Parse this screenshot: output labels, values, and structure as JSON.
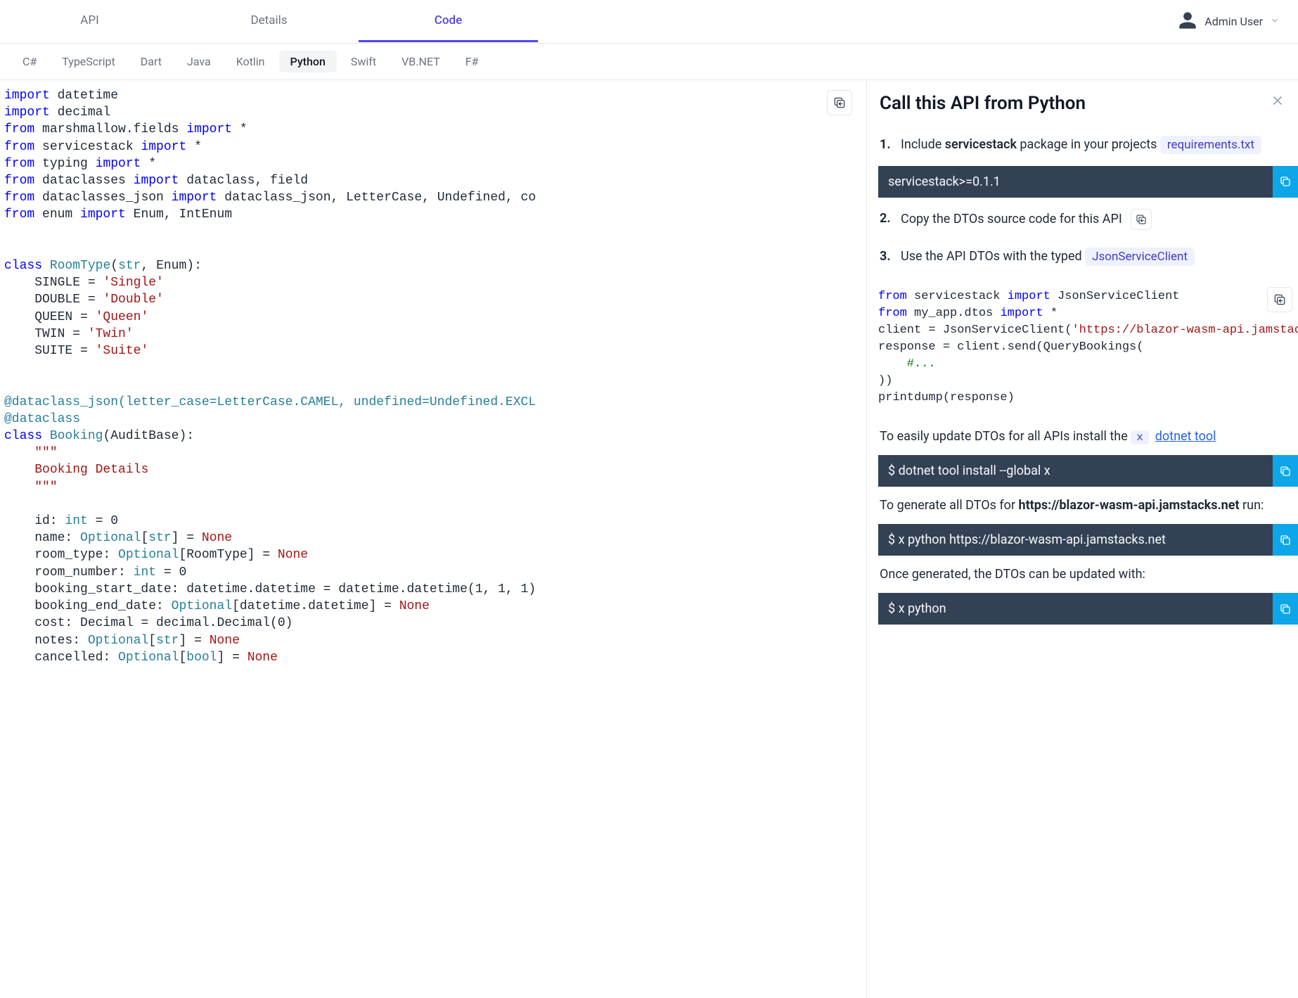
{
  "header": {
    "tabs": [
      "API",
      "Details",
      "Code"
    ],
    "active_tab": 2,
    "user": "Admin User"
  },
  "lang_tabs": {
    "items": [
      "C#",
      "TypeScript",
      "Dart",
      "Java",
      "Kotlin",
      "Python",
      "Swift",
      "VB.NET",
      "F#"
    ],
    "active": 5
  },
  "code": {
    "imports": [
      {
        "type": "import",
        "module": "datetime"
      },
      {
        "type": "import",
        "module": "decimal"
      },
      {
        "type": "from",
        "module": "marshmallow.fields",
        "what": "*"
      },
      {
        "type": "from",
        "module": "servicestack",
        "what": "*"
      },
      {
        "type": "from",
        "module": "typing",
        "what": "*"
      },
      {
        "type": "from",
        "module": "dataclasses",
        "what": "dataclass, field"
      },
      {
        "type": "from",
        "module": "dataclasses_json",
        "what": "dataclass_json, LetterCase, Undefined, co"
      },
      {
        "type": "from",
        "module": "enum",
        "what": "Enum, IntEnum"
      }
    ],
    "enum": {
      "name": "RoomType",
      "bases": "str, Enum",
      "members": [
        {
          "name": "SINGLE",
          "value": "'Single'"
        },
        {
          "name": "DOUBLE",
          "value": "'Double'"
        },
        {
          "name": "QUEEN",
          "value": "'Queen'"
        },
        {
          "name": "TWIN",
          "value": "'Twin'"
        },
        {
          "name": "SUITE",
          "value": "'Suite'"
        }
      ]
    },
    "decorator1": "@dataclass_json(letter_case=LetterCase.CAMEL, undefined=Undefined.EXCL",
    "decorator2": "@dataclass",
    "class": {
      "name": "Booking",
      "base": "AuditBase",
      "docstring": "Booking Details",
      "fields": [
        {
          "raw": "id: int = 0",
          "name": "id",
          "type": "int",
          "default": "0"
        },
        {
          "raw": "name: Optional[str] = None",
          "name": "name",
          "type": "Optional[str]",
          "default": "None"
        },
        {
          "raw": "room_type: Optional[RoomType] = None",
          "name": "room_type",
          "type": "Optional[RoomType]",
          "default": "None"
        },
        {
          "raw": "room_number: int = 0",
          "name": "room_number",
          "type": "int",
          "default": "0"
        },
        {
          "raw": "booking_start_date: datetime.datetime = datetime.datetime(1, 1, 1)",
          "name": "booking_start_date",
          "type": "datetime.datetime",
          "default": "datetime.datetime(1, 1, 1)"
        },
        {
          "raw": "booking_end_date: Optional[datetime.datetime] = None",
          "name": "booking_end_date",
          "type": "Optional[datetime.datetime]",
          "default": "None"
        },
        {
          "raw": "cost: Decimal = decimal.Decimal(0)",
          "name": "cost",
          "type": "Decimal",
          "default": "decimal.Decimal(0)"
        },
        {
          "raw": "notes: Optional[str] = None",
          "name": "notes",
          "type": "Optional[str]",
          "default": "None"
        },
        {
          "raw": "cancelled: Optional[bool] = None",
          "name": "cancelled",
          "type": "Optional[bool]",
          "default": "None"
        }
      ]
    }
  },
  "panel": {
    "title": "Call this API from Python",
    "step1_prefix": "Include ",
    "step1_pkg": "servicestack",
    "step1_suffix": " package in your projects  ",
    "step1_pill": "requirements.txt",
    "cmd1": "servicestack>=0.1.1",
    "step2": "Copy the DTOs source code for this API",
    "step3_prefix": "Use the API DTOs with the typed  ",
    "step3_pill": "JsonServiceClient",
    "example": {
      "l1_from": "from",
      "l1_mod": "servicestack",
      "l1_imp": "import",
      "l1_what": "JsonServiceClient",
      "l2_from": "from",
      "l2_mod": "my_app.dtos",
      "l2_imp": "import",
      "l2_what": "*",
      "l3": "client = JsonServiceClient(",
      "l3_str": "'https://blazor-wasm-api.jamstacks.net'",
      "l3_end": ")",
      "l4": "response = client.send(QueryBookings(",
      "l5": "    #...",
      "l6": "))",
      "l7": "printdump(response)"
    },
    "para1_prefix": "To easily update DTOs for all APIs install the ",
    "para1_mono": "x",
    "para1_link": "dotnet tool",
    "cmd2": "$ dotnet tool install --global x",
    "para2_prefix": "To generate all DTOs for ",
    "para2_url": "https://blazor-wasm-api.jamstacks.net",
    "para2_suffix": " run:",
    "cmd3": "$ x python https://blazor-wasm-api.jamstacks.net",
    "para3": "Once generated, the DTOs can be updated with:",
    "cmd4": "$ x python"
  }
}
